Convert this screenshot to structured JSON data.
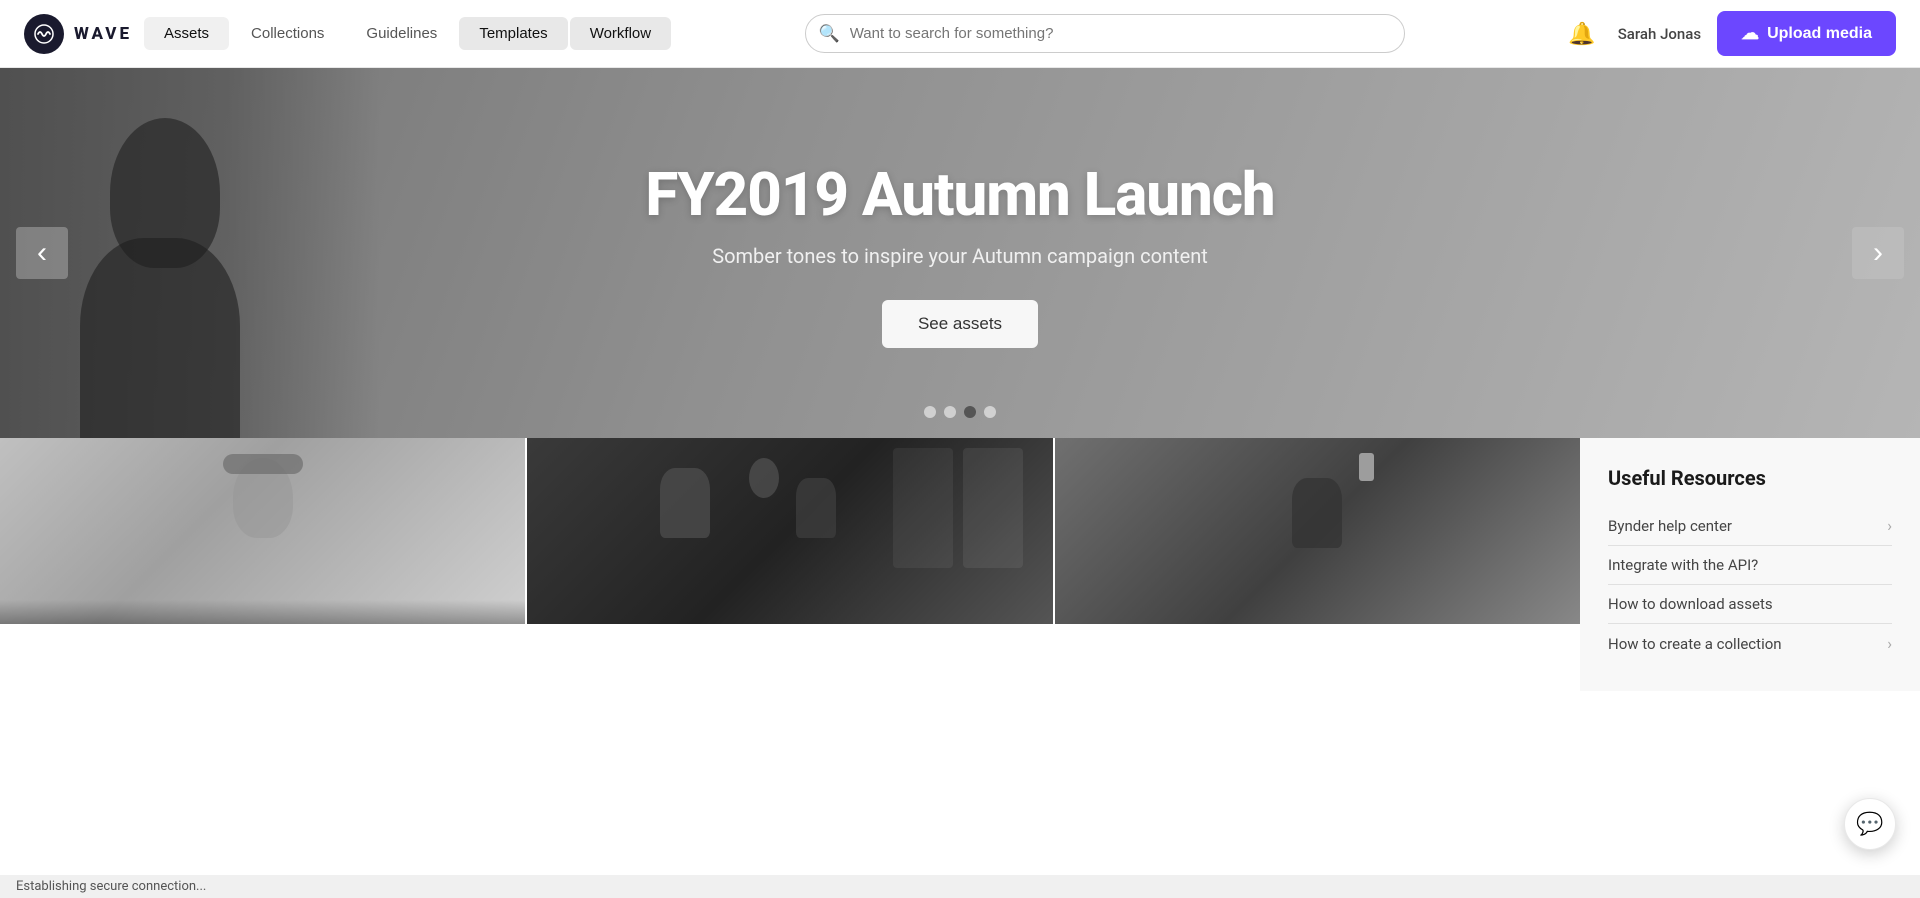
{
  "app": {
    "name": "WAVE"
  },
  "header": {
    "logo_text": "WAVE",
    "search_placeholder": "Want to search for something?",
    "nav_items": [
      {
        "id": "assets",
        "label": "Assets",
        "active": true,
        "highlighted": false
      },
      {
        "id": "collections",
        "label": "Collections",
        "active": false,
        "highlighted": false
      },
      {
        "id": "guidelines",
        "label": "Guidelines",
        "active": false,
        "highlighted": false
      },
      {
        "id": "templates",
        "label": "Templates",
        "active": false,
        "highlighted": true
      },
      {
        "id": "workflow",
        "label": "Workflow",
        "active": false,
        "highlighted": true
      }
    ],
    "username": "Sarah Jonas",
    "upload_label": "Upload media"
  },
  "hero": {
    "title": "FY2019 Autumn Launch",
    "subtitle": "Somber tones to inspire your Autumn campaign content",
    "cta_label": "See assets",
    "prev_label": "‹",
    "next_label": "›",
    "dots": [
      {
        "id": 1,
        "active": false
      },
      {
        "id": 2,
        "active": false
      },
      {
        "id": 3,
        "active": true
      },
      {
        "id": 4,
        "active": false
      }
    ]
  },
  "media_cards": [
    {
      "id": 1,
      "alt": "Person with headphones"
    },
    {
      "id": 2,
      "alt": "Film crew with camera"
    },
    {
      "id": 3,
      "alt": "Person with phone raised"
    }
  ],
  "sidebar": {
    "title": "Useful Resources",
    "links": [
      {
        "id": "bynder-help",
        "label": "Bynder help center",
        "has_chevron": true
      },
      {
        "id": "integrate-api",
        "label": "Integrate with the API?",
        "has_chevron": false
      },
      {
        "id": "download-assets",
        "label": "How to download assets",
        "has_chevron": false
      },
      {
        "id": "create-collection",
        "label": "How to create a collection",
        "has_chevron": true
      }
    ]
  },
  "status_bar": {
    "message": "Establishing secure connection..."
  }
}
